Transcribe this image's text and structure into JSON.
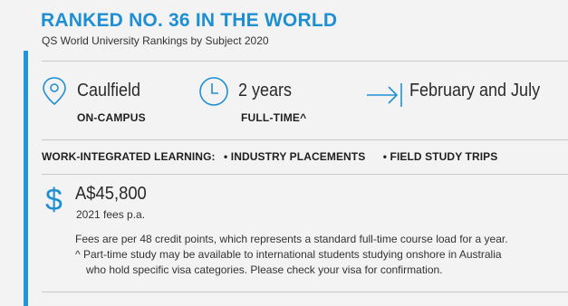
{
  "ranking": {
    "title": "RANKED NO. 36 IN THE WORLD",
    "subtitle": "QS World University Rankings by Subject 2020"
  },
  "facts": {
    "location": {
      "icon": "location-pin-icon",
      "value": "Caulfield",
      "sub": "ON-CAMPUS"
    },
    "duration": {
      "icon": "clock-icon",
      "value": "2 years",
      "sub": "FULL-TIME^"
    },
    "intake": {
      "icon": "arrow-right-icon",
      "value": "February and July"
    }
  },
  "wil": {
    "label": "WORK-INTEGRATED LEARNING:",
    "items": [
      "• INDUSTRY PLACEMENTS",
      "• FIELD STUDY TRIPS"
    ]
  },
  "fees": {
    "icon": "dollar-icon",
    "symbol": "$",
    "amount": "A$45,800",
    "period": "2021 fees p.a.",
    "note1": "Fees are per 48 credit points, which represents a standard full-time course load for a year.",
    "note2a": "^ Part-time study may be available to international students studying onshore in Australia",
    "note2b": "who hold specific visa categories. Please check your visa for confirmation."
  },
  "colors": {
    "accent": "#1f8fd3",
    "background": "#f3f3f3"
  }
}
